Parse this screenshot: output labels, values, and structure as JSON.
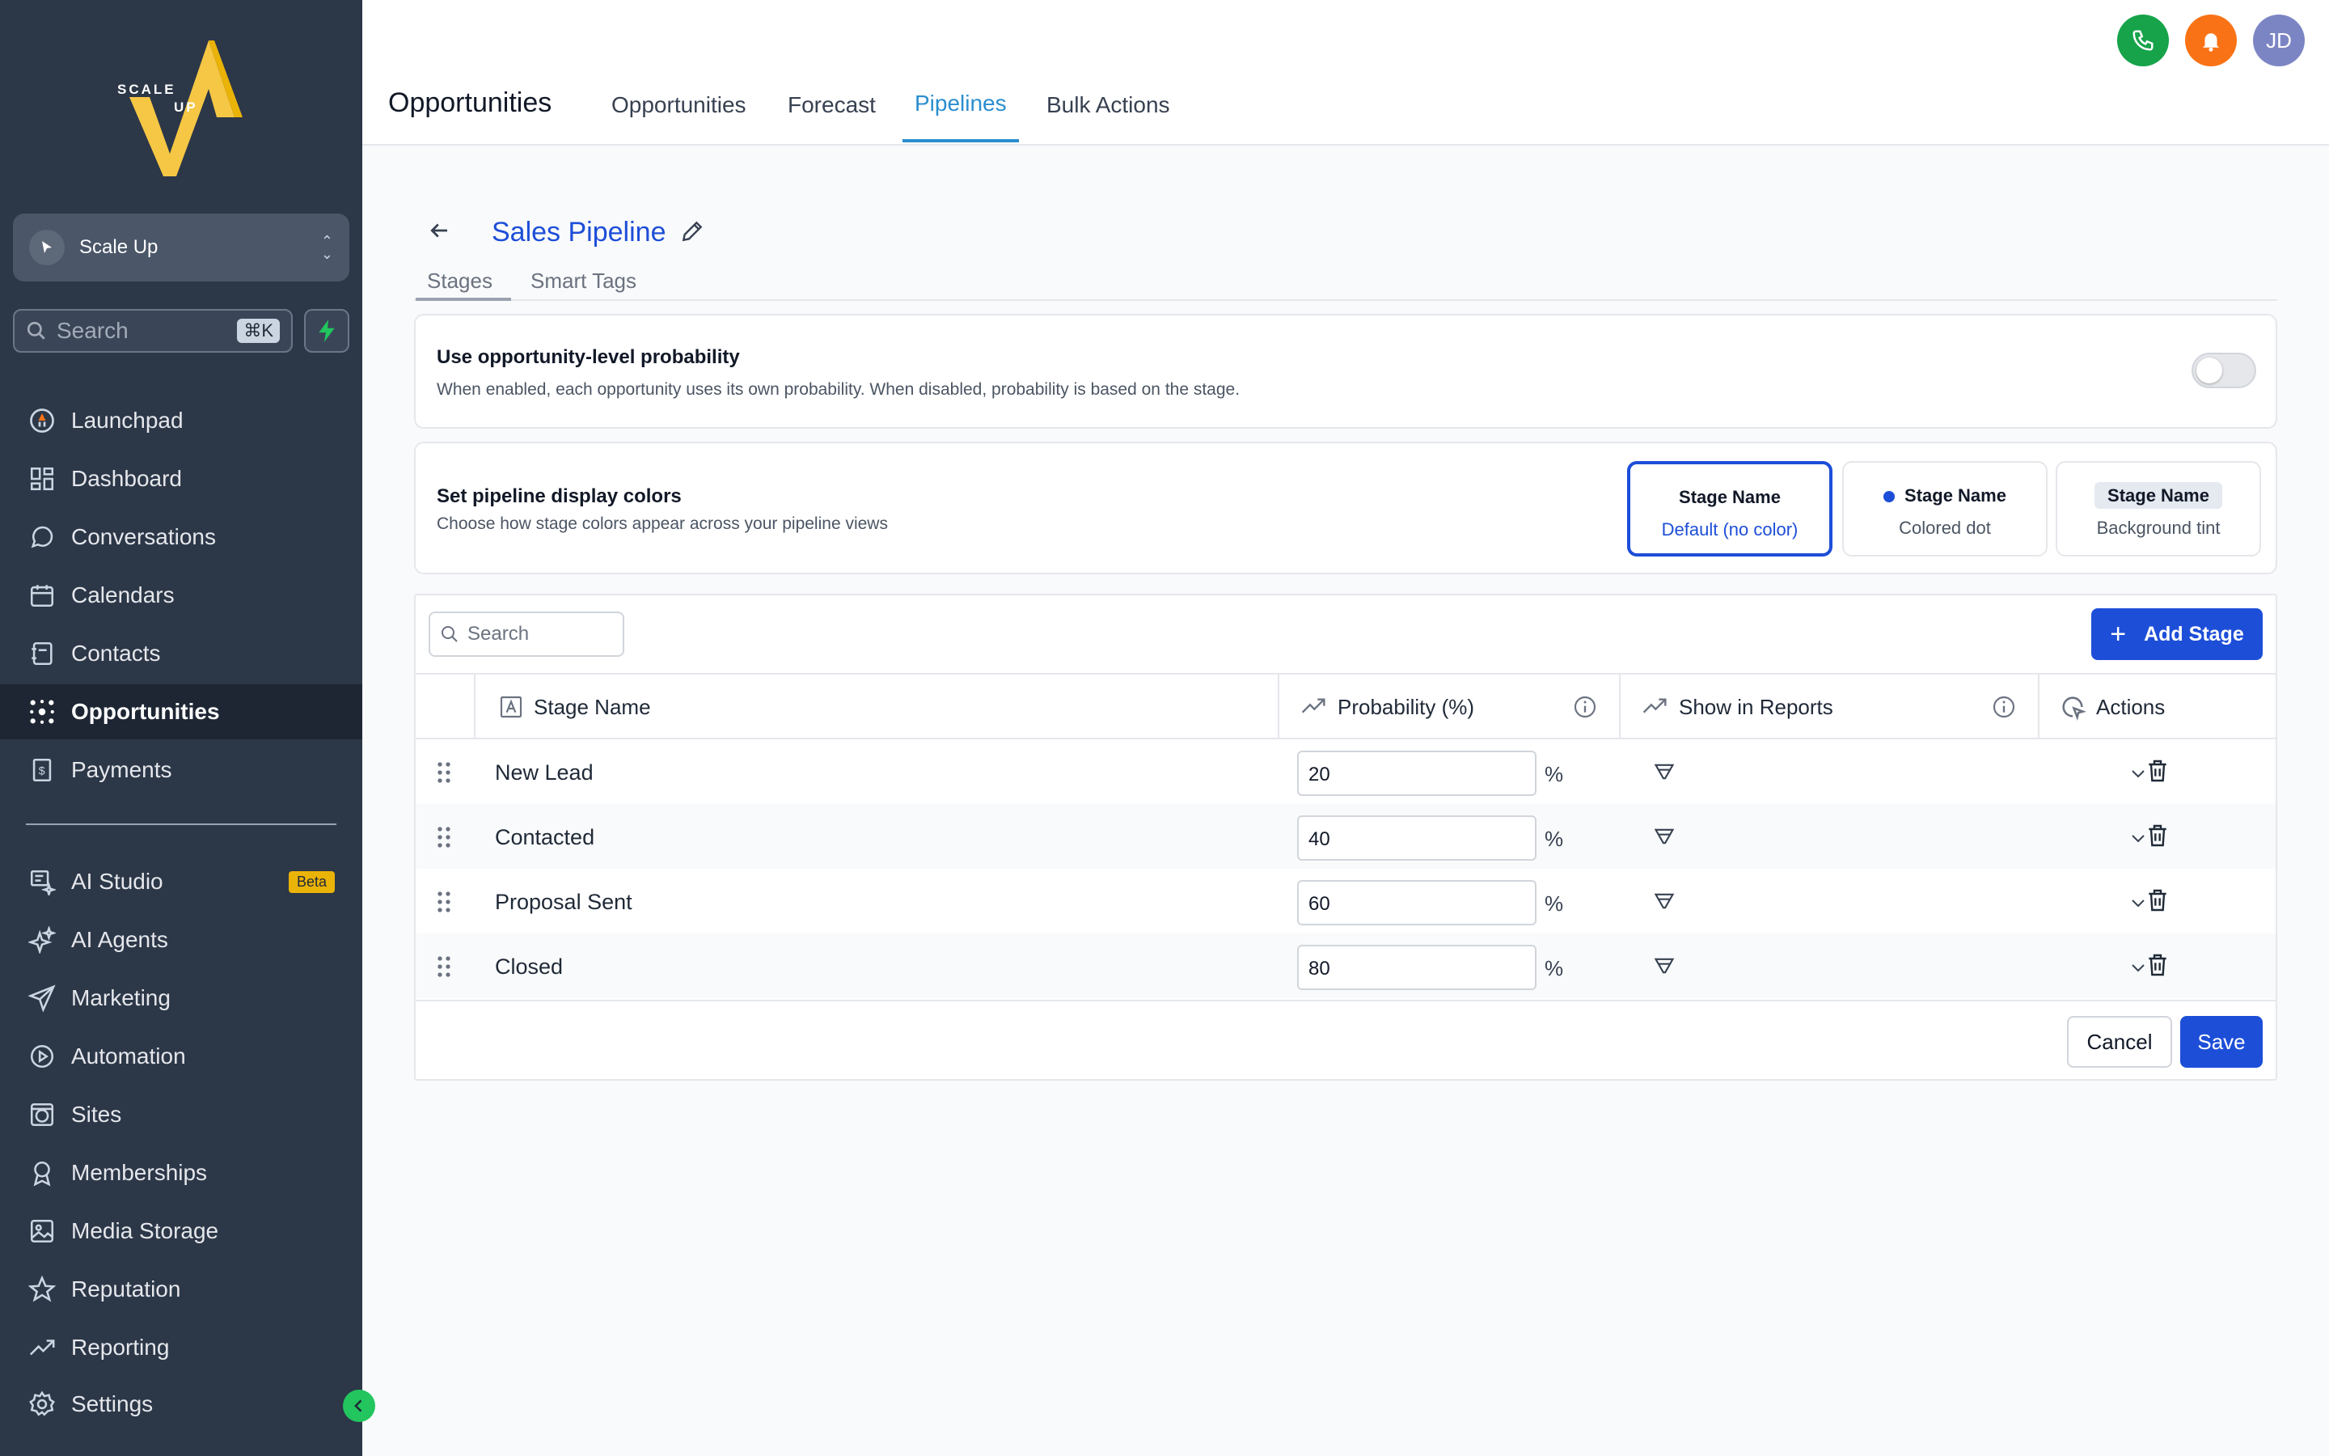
{
  "sidebar": {
    "logo": {
      "text_top": "SCALE",
      "text_bottom": "UP"
    },
    "account": {
      "name": "Scale Up"
    },
    "search": {
      "placeholder": "Search",
      "shortcut": "⌘K"
    },
    "nav_primary": [
      {
        "label": "Launchpad",
        "icon": "rocket-icon"
      },
      {
        "label": "Dashboard",
        "icon": "dashboard-icon"
      },
      {
        "label": "Conversations",
        "icon": "chat-icon"
      },
      {
        "label": "Calendars",
        "icon": "calendar-icon"
      },
      {
        "label": "Contacts",
        "icon": "contacts-icon"
      },
      {
        "label": "Opportunities",
        "icon": "opportunities-icon",
        "active": true
      },
      {
        "label": "Payments",
        "icon": "payments-icon"
      }
    ],
    "nav_secondary": [
      {
        "label": "AI Studio",
        "icon": "ai-studio-icon",
        "badge": "Beta"
      },
      {
        "label": "AI Agents",
        "icon": "sparkle-icon"
      },
      {
        "label": "Marketing",
        "icon": "send-icon"
      },
      {
        "label": "Automation",
        "icon": "automation-icon"
      },
      {
        "label": "Sites",
        "icon": "globe-icon"
      },
      {
        "label": "Memberships",
        "icon": "badge-icon"
      },
      {
        "label": "Media Storage",
        "icon": "image-icon"
      },
      {
        "label": "Reputation",
        "icon": "star-icon"
      },
      {
        "label": "Reporting",
        "icon": "trend-icon"
      },
      {
        "label": "Settings",
        "icon": "gear-icon"
      }
    ]
  },
  "header": {
    "title": "Opportunities",
    "tabs": [
      {
        "label": "Opportunities"
      },
      {
        "label": "Forecast"
      },
      {
        "label": "Pipelines",
        "active": true
      },
      {
        "label": "Bulk Actions"
      }
    ],
    "avatar_initials": "JD"
  },
  "pipeline": {
    "title": "Sales Pipeline",
    "subtabs": [
      {
        "label": "Stages",
        "active": true
      },
      {
        "label": "Smart Tags"
      }
    ]
  },
  "probability_card": {
    "title": "Use opportunity-level probability",
    "description": "When enabled, each opportunity uses its own probability. When disabled, probability is based on the stage.",
    "enabled": false
  },
  "colors_card": {
    "title": "Set pipeline display colors",
    "description": "Choose how stage colors appear across your pipeline views",
    "options": [
      {
        "title": "Stage Name",
        "subtitle": "Default (no color)",
        "selected": true
      },
      {
        "title": "Stage Name",
        "subtitle": "Colored dot"
      },
      {
        "title": "Stage Name",
        "subtitle": "Background tint"
      }
    ]
  },
  "stages_table": {
    "search_placeholder": "Search",
    "add_button": "Add Stage",
    "columns": [
      "Stage Name",
      "Probability (%)",
      "Show in Reports",
      "Actions"
    ],
    "percent_symbol": "%",
    "rows": [
      {
        "name": "New Lead",
        "probability": "20"
      },
      {
        "name": "Contacted",
        "probability": "40"
      },
      {
        "name": "Proposal Sent",
        "probability": "60"
      },
      {
        "name": "Closed",
        "probability": "80"
      }
    ],
    "cancel": "Cancel",
    "save": "Save"
  },
  "colors": {
    "primary": "#1d4ed8",
    "tab_active": "#2b8ecf",
    "sidebar_bg": "#2c3748",
    "phone_btn": "#16a34a",
    "bell_btn": "#f97316",
    "avatar_bg": "#7c85c4",
    "beta_badge": "#eab308"
  }
}
